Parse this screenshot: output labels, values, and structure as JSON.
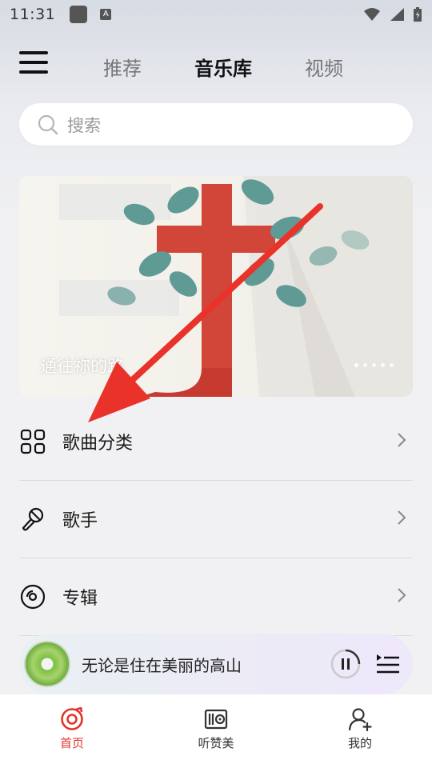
{
  "status_bar": {
    "time": "11:31",
    "icons": [
      "app-icon",
      "a-icon",
      "wifi-icon",
      "signal-icon",
      "battery-icon"
    ],
    "small_icon_letter": "A"
  },
  "header": {
    "tabs": [
      {
        "label": "推荐",
        "active": false
      },
      {
        "label": "音乐库",
        "active": true
      },
      {
        "label": "视频",
        "active": false
      }
    ]
  },
  "search": {
    "placeholder": "搜索"
  },
  "banner": {
    "caption": "通往祢的路",
    "page_count": 5,
    "active_index": 0
  },
  "menu": {
    "items": [
      {
        "label": "歌曲分类",
        "icon": "grid-icon"
      },
      {
        "label": "歌手",
        "icon": "microphone-icon"
      },
      {
        "label": "专辑",
        "icon": "disc-icon"
      }
    ]
  },
  "player": {
    "song_title": "无论是住在美丽的高山",
    "progress": 0.25
  },
  "bottom_nav": {
    "items": [
      {
        "label": "首页",
        "icon": "home-disc-icon",
        "active": true
      },
      {
        "label": "听赞美",
        "icon": "radio-icon",
        "active": false
      },
      {
        "label": "我的",
        "icon": "person-icon",
        "active": false
      }
    ]
  },
  "colors": {
    "accent": "#e1352c",
    "arrow": "#e8322a",
    "text_primary": "#1a1a1a",
    "text_muted": "#777777",
    "background": "#f1f1f3"
  }
}
